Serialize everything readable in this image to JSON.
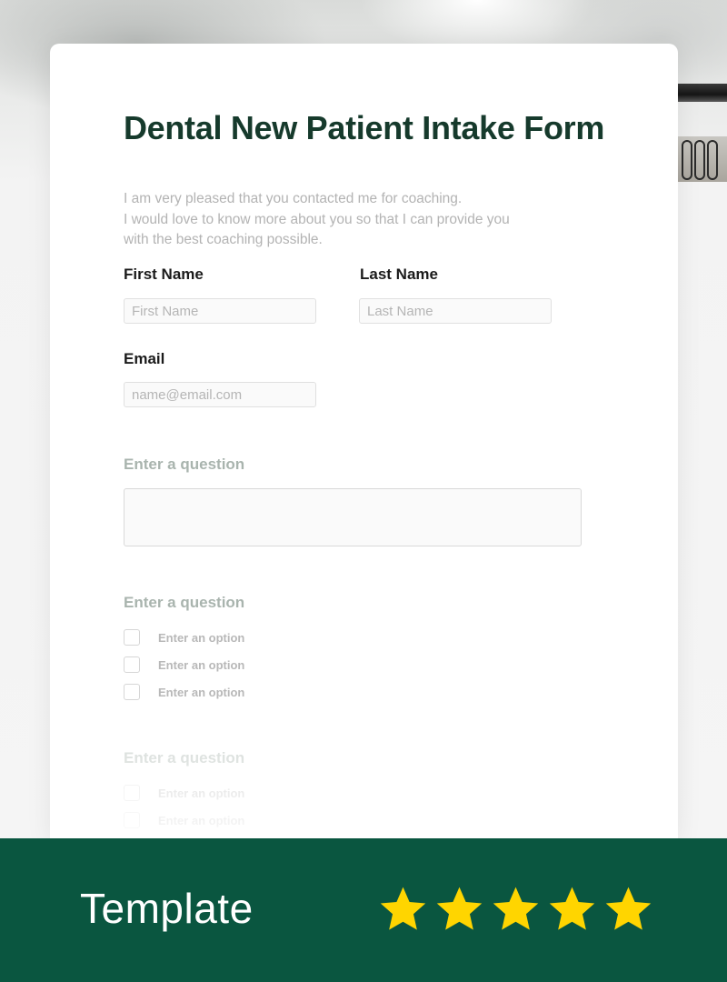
{
  "form": {
    "title": "Dental New Patient Intake Form",
    "intro_lines": [
      "I am very pleased that you contacted me for coaching.",
      "I would love to know more about you so that I can provide you",
      "with the best coaching possible."
    ],
    "first_name": {
      "label": "First Name",
      "placeholder": "First Name"
    },
    "last_name": {
      "label": "Last Name",
      "placeholder": "Last Name"
    },
    "email": {
      "label": "Email",
      "placeholder": "name@email.com"
    },
    "questions": [
      {
        "label": "Enter a question"
      },
      {
        "label": "Enter a question",
        "options": [
          "Enter an option",
          "Enter an option",
          "Enter an option"
        ]
      },
      {
        "label": "Enter a question",
        "options": [
          "Enter an option",
          "Enter an option"
        ]
      }
    ]
  },
  "banner": {
    "text": "Template",
    "rating": 5,
    "star_color": "#ffd500",
    "background": "#0a5640"
  }
}
